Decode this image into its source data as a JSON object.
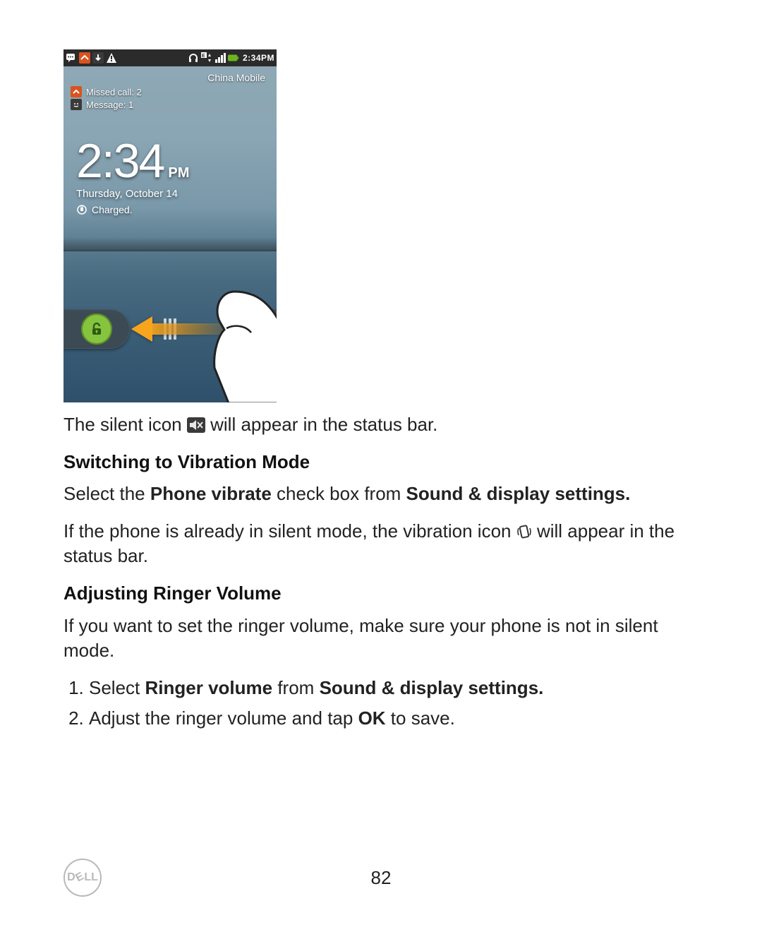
{
  "phone": {
    "statusbar": {
      "time": "2:34PM"
    },
    "carrier": "China Mobile",
    "notifications": {
      "missed_call": "Missed call: 2",
      "message": "Message: 1"
    },
    "clock": {
      "time": "2:34",
      "ampm": "PM",
      "date": "Thursday, October 14",
      "charged": "Charged."
    }
  },
  "doc": {
    "p1_a": "The silent icon ",
    "p1_b": " will appear in the status bar.",
    "h1": "Switching to Vibration Mode",
    "p2_a": "Select the ",
    "p2_b1": "Phone vibrate",
    "p2_c": " check box from ",
    "p2_b2": "Sound & display settings.",
    "p3_a": "If the phone is already in silent mode, the vibration icon ",
    "p3_b": " will appear in the status bar.",
    "h2": "Adjusting Ringer Volume",
    "p4": "If you want to set the ringer volume, make sure your phone is not in silent mode.",
    "li1_a": "Select ",
    "li1_b1": "Ringer volume",
    "li1_c": " from ",
    "li1_b2": "Sound & display settings.",
    "li2_a": "Adjust the ringer volume and tap ",
    "li2_b": "OK",
    "li2_c": " to save."
  },
  "footer": {
    "page": "82",
    "brand": "DELL"
  }
}
